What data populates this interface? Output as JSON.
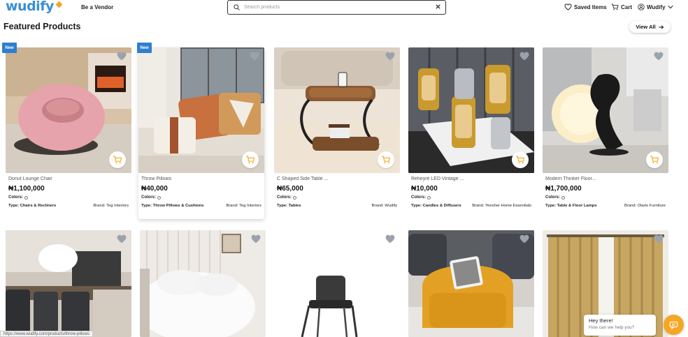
{
  "header": {
    "logo": "wudify",
    "vendor_link": "Be a Vendor",
    "search_placeholder": "Search products",
    "saved_items": "Saved Items",
    "cart": "Cart",
    "account": "Wudify"
  },
  "section": {
    "title": "Featured Products",
    "view_all": "View All"
  },
  "labels": {
    "colors": "Colors:",
    "type_prefix": "Type:",
    "brand_prefix": "Brand:",
    "new_badge": "New"
  },
  "products": [
    {
      "name": "Donut Lounge Chair",
      "price": "₦1,100,000",
      "type": "Chairs & Recliners",
      "brand": "Teg Interiors",
      "new": true
    },
    {
      "name": "Throw Pillows",
      "price": "₦40,000",
      "type": "Throw Pillows & Cushions",
      "brand": "Teg Interiors",
      "new": true
    },
    {
      "name": "C Shaped Side Table ...",
      "price": "₦65,000",
      "type": "Tables",
      "brand": "Wudify",
      "new": false
    },
    {
      "name": "Reheyre LED Vintage ...",
      "price": "₦10,000",
      "type": "Candles & Diffusers",
      "brand": "Yeesher Home Essentials",
      "new": false
    },
    {
      "name": "Modern Thinker Floor...",
      "price": "₦1,700,000",
      "type": "Table & Floor Lamps",
      "brand": "Olario Furniture",
      "new": false
    }
  ],
  "status_url": "https://www.wudify.com/products/throw-pillows",
  "chat": {
    "greeting": "Hey there!",
    "prompt": "How can we help you?"
  },
  "colors": {
    "brand_blue": "#3a8fd4",
    "accent_orange": "#f5a623",
    "heart_gray": "#9aa3ad"
  }
}
